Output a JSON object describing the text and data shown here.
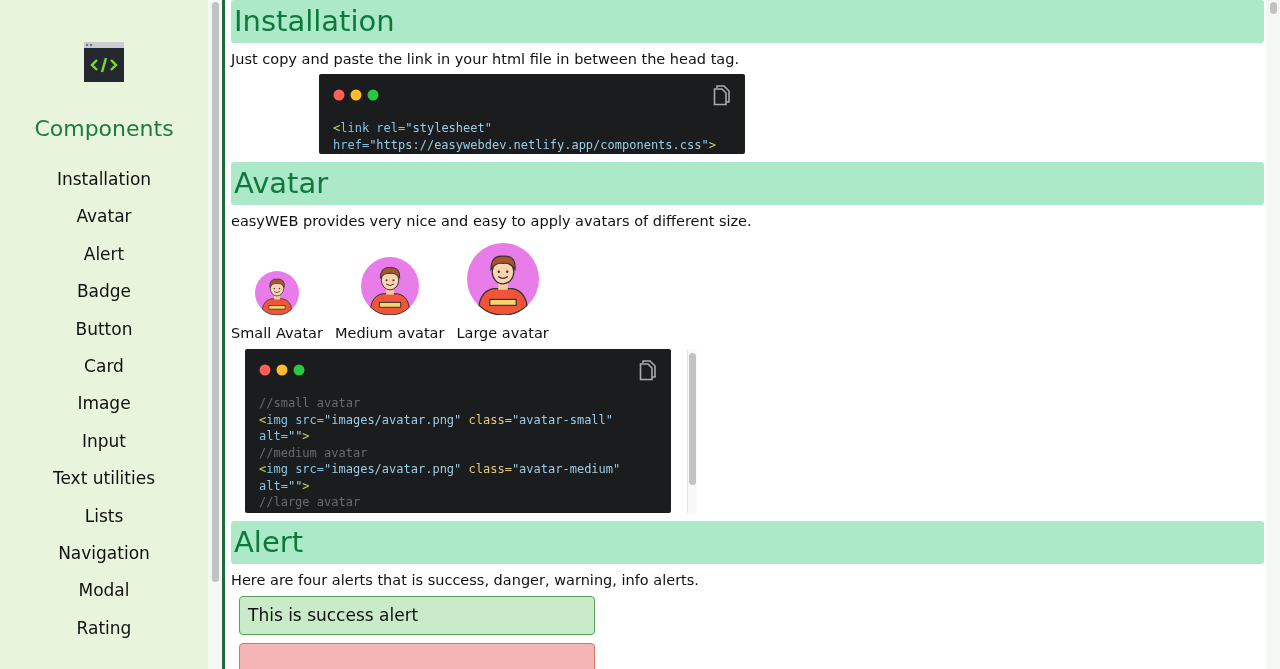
{
  "sidebar": {
    "title": "Components",
    "items": [
      {
        "label": "Installation"
      },
      {
        "label": "Avatar"
      },
      {
        "label": "Alert"
      },
      {
        "label": "Badge"
      },
      {
        "label": "Button"
      },
      {
        "label": "Card"
      },
      {
        "label": "Image"
      },
      {
        "label": "Input"
      },
      {
        "label": "Text utilities"
      },
      {
        "label": "Lists"
      },
      {
        "label": "Navigation"
      },
      {
        "label": "Modal"
      },
      {
        "label": "Rating"
      }
    ]
  },
  "sections": [
    {
      "heading": "Installation",
      "text": "Just copy and paste the link in your html file in between the head tag.",
      "content": [
        {
          "kind": "code",
          "scroll": false,
          "lines": [
            [
              {
                "t": "<",
                "kind": "punct"
              },
              {
                "t": "link rel=",
                "kind": "attr"
              },
              {
                "t": "\"stylesheet\"",
                "kind": "string"
              }
            ],
            [
              {
                "t": "href=",
                "kind": "attr"
              },
              {
                "t": "\"https://easywebdev.netlify.app/components.css\"",
                "kind": "string"
              },
              {
                "t": ">",
                "kind": "punct"
              }
            ]
          ]
        }
      ]
    },
    {
      "heading": "Avatar",
      "text": "easyWEB provides very nice and easy to apply avatars of different size.",
      "content": [
        {
          "kind": "avatars",
          "items": [
            {
              "label": "Small Avatar",
              "kind": "small"
            },
            {
              "label": "Medium avatar",
              "kind": "medium"
            },
            {
              "label": "Large avatar",
              "kind": "large"
            }
          ]
        },
        {
          "kind": "code",
          "scroll": true,
          "lines": [
            [
              {
                "t": "//small avatar",
                "kind": "comment"
              }
            ],
            [
              {
                "t": "<",
                "kind": "punct"
              },
              {
                "t": "img src=",
                "kind": "attr"
              },
              {
                "t": "\"images/avatar.png\"",
                "kind": "string"
              },
              {
                "t": " class=",
                "kind": "keyword"
              },
              {
                "t": "\"avatar-small\"",
                "kind": "string"
              }
            ],
            [
              {
                "t": "alt=",
                "kind": "attr"
              },
              {
                "t": "\"\"",
                "kind": "string"
              },
              {
                "t": ">",
                "kind": "punct"
              }
            ],
            [
              {
                "t": "//medium avatar",
                "kind": "comment"
              }
            ],
            [
              {
                "t": "<",
                "kind": "punct"
              },
              {
                "t": "img src=",
                "kind": "attr"
              },
              {
                "t": "\"images/avatar.png\"",
                "kind": "string"
              },
              {
                "t": " class=",
                "kind": "keyword"
              },
              {
                "t": "\"avatar-medium\"",
                "kind": "string"
              }
            ],
            [
              {
                "t": "alt=",
                "kind": "attr"
              },
              {
                "t": "\"\"",
                "kind": "string"
              },
              {
                "t": ">",
                "kind": "punct"
              }
            ],
            [
              {
                "t": "//large avatar",
                "kind": "comment"
              }
            ]
          ]
        }
      ]
    },
    {
      "heading": "Alert",
      "text": "Here are four alerts that is success, danger, warning, info alerts.",
      "content": [
        {
          "kind": "alerts",
          "items": [
            {
              "kind": "success",
              "text": "This is success alert"
            },
            {
              "kind": "danger"
            }
          ]
        }
      ]
    }
  ]
}
